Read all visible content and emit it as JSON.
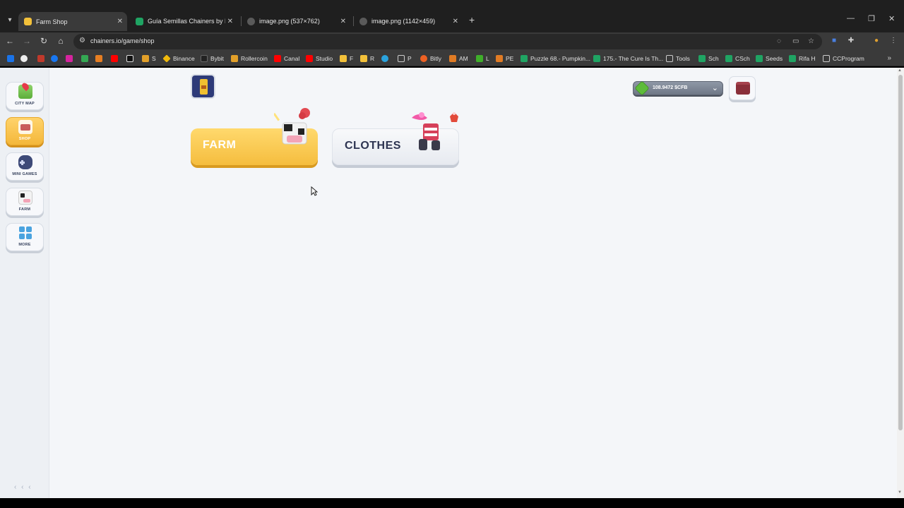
{
  "browser": {
    "tabs": [
      {
        "title": "Farm Shop",
        "active": true
      },
      {
        "title": "Guía Semillas Chainers by Piero",
        "active": false
      },
      {
        "title": "image.png (537×762)",
        "active": false
      },
      {
        "title": "image.png (1142×459)",
        "active": false
      }
    ],
    "url": "chainers.io/game/shop",
    "bookmarks": [
      "S",
      "Binance",
      "Bybit",
      "Rollercoin",
      "Canal",
      "Studio",
      "F",
      "R",
      "P",
      "Bitly",
      "AM",
      "L",
      "PE",
      "Puzzle 68.- Pumpkin...",
      "175.- The Cure Is Th...",
      "Tools",
      "Sch",
      "CSch",
      "Seeds",
      "Rifa H",
      "CCProgram"
    ]
  },
  "sidebar": {
    "items": [
      {
        "label": "CITY MAP",
        "icon": "map-pin-icon",
        "active": false
      },
      {
        "label": "SHOP",
        "icon": "shop-cart-icon",
        "active": true
      },
      {
        "label": "MINI GAMES",
        "icon": "gamepad-icon",
        "active": false
      },
      {
        "label": "FARM",
        "icon": "cow-icon",
        "active": false
      },
      {
        "label": "MORE",
        "icon": "grid-icon",
        "active": false
      }
    ],
    "collapse_glyph": "‹ ‹ ‹"
  },
  "shop": {
    "categories": [
      {
        "label": "FARM",
        "active": true
      },
      {
        "label": "CLOTHES",
        "active": false
      }
    ]
  },
  "wallet": {
    "amount": "108.9472 $CFB",
    "icon": "cfb-gem-icon"
  },
  "colors": {
    "accent": "#f5bd3e",
    "page_bg": "#f4f6f9",
    "text_dark": "#2e3552"
  }
}
